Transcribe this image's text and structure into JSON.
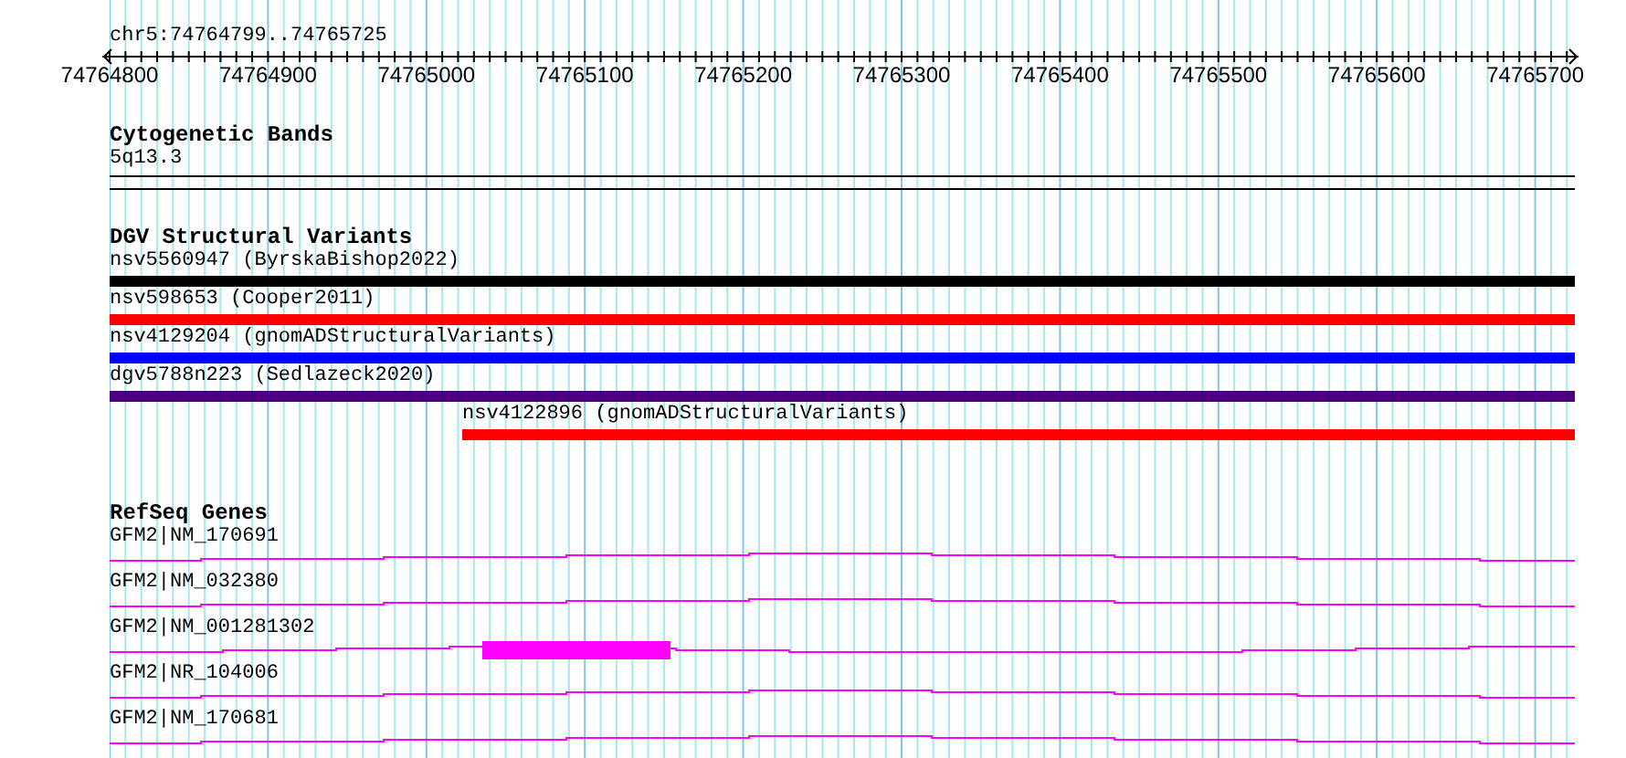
{
  "ruler": {
    "location": "chr5:74764799..74765725",
    "labels": [
      "74764800",
      "74764900",
      "74765000",
      "74765100",
      "74765200",
      "74765300",
      "74765400",
      "74765500",
      "74765600",
      "74765700"
    ]
  },
  "cytogenetic_bands": {
    "title": "Cytogenetic Bands",
    "band": "5q13.3"
  },
  "dgv": {
    "title": "DGV Structural Variants",
    "variants": [
      {
        "label": "nsv5560947 (ByrskaBishop2022)",
        "color": "#000000",
        "kind": "spanning"
      },
      {
        "label": "nsv598653 (Cooper2011)",
        "color": "#ff0000",
        "kind": "spanning"
      },
      {
        "label": "nsv4129204 (gnomADStructuralVariants)",
        "color": "#0000ff",
        "kind": "spanning"
      },
      {
        "label": "dgv5788n223 (Sedlazeck2020)",
        "color": "#4b0082",
        "kind": "spanning"
      },
      {
        "label": "nsv4122896 (gnomADStructuralVariants)",
        "color": "#ff0000",
        "kind": "inset"
      }
    ]
  },
  "refseq": {
    "title": "RefSeq Genes",
    "genes": [
      {
        "label": "GFM2|NM_170691",
        "kind": "intron"
      },
      {
        "label": "GFM2|NM_032380",
        "kind": "intron"
      },
      {
        "label": "GFM2|NM_001281302",
        "kind": "exon"
      },
      {
        "label": "GFM2|NR_104006",
        "kind": "intron"
      },
      {
        "label": "GFM2|NM_170681",
        "kind": "intron"
      }
    ]
  }
}
